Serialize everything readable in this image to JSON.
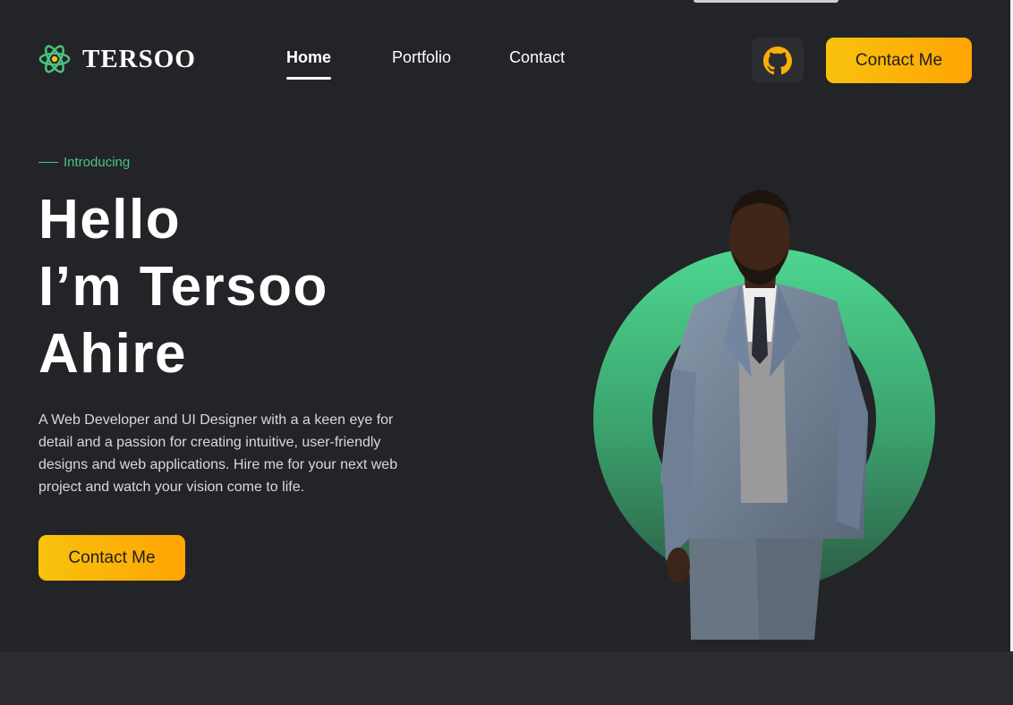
{
  "brand": {
    "name": "TERSOO",
    "logo_icon": "react-atom-icon",
    "logo_color": "#49c57f"
  },
  "nav": {
    "items": [
      {
        "label": "Home",
        "active": true
      },
      {
        "label": "Portfolio",
        "active": false
      },
      {
        "label": "Contact",
        "active": false
      }
    ]
  },
  "header": {
    "github_icon": "github-icon",
    "cta_label": "Contact Me"
  },
  "hero": {
    "intro": "Introducing",
    "headline": [
      "Hello",
      "I’m Tersoo",
      "Ahire"
    ],
    "description": "A Web Developer and UI Designer with a a keen eye for detail and a passion for creating intuitive, user-friendly designs and web applications. Hire me for your next web project and watch your vision come to life.",
    "cta_label": "Contact Me"
  },
  "colors": {
    "background": "#232427",
    "accent_green": "#49c57f",
    "accent_yellow": "#f8c20d",
    "accent_orange": "#ffa404"
  }
}
